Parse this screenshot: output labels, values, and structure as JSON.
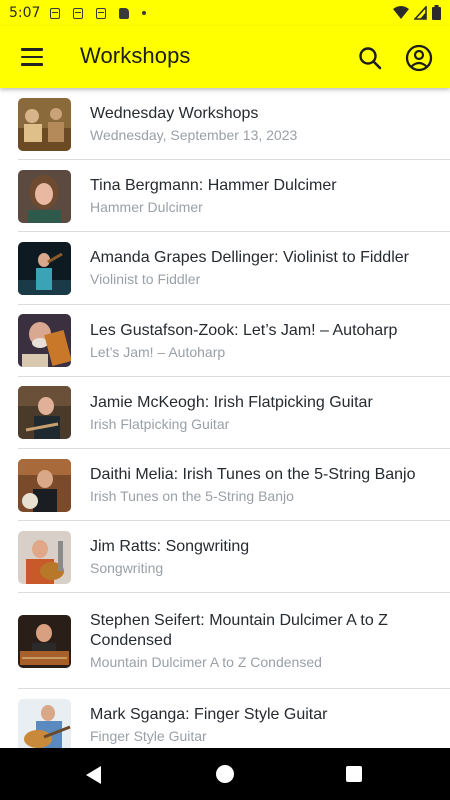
{
  "status_bar": {
    "time": "5:07",
    "icons": [
      "calendar-icon",
      "calendar-icon",
      "calendar-icon",
      "sd-card-icon",
      "dot-icon"
    ],
    "right_icons": [
      "wifi-icon",
      "signal-icon",
      "battery-icon"
    ]
  },
  "app_bar": {
    "title": "Workshops",
    "background": "#ffff00",
    "menu_icon": "menu-icon",
    "search_icon": "search-icon",
    "account_icon": "account-icon"
  },
  "workshops": [
    {
      "title": "Wednesday Workshops",
      "subtitle": "Wednesday, September 13, 2023"
    },
    {
      "title": "Tina Bergmann: Hammer Dulcimer",
      "subtitle": "Hammer Dulcimer"
    },
    {
      "title": "Amanda Grapes Dellinger: Violinist to Fiddler",
      "subtitle": "Violinist to Fiddler"
    },
    {
      "title": "Les Gustafson-Zook:  Let’s Jam! – Autoharp",
      "subtitle": "Let’s Jam! – Autoharp"
    },
    {
      "title": "Jamie McKeogh:  Irish Flatpicking Guitar",
      "subtitle": "Irish Flatpicking Guitar"
    },
    {
      "title": "Daithi Melia:  Irish Tunes on the 5-String Banjo",
      "subtitle": "Irish Tunes on the 5-String Banjo"
    },
    {
      "title": "Jim Ratts: Songwriting",
      "subtitle": "Songwriting"
    },
    {
      "title": "Stephen Seifert:  Mountain Dulcimer A to Z Condensed",
      "subtitle": "Mountain Dulcimer A to Z Condensed"
    },
    {
      "title": "Mark Sganga: Finger Style Guitar",
      "subtitle": "Finger Style Guitar"
    }
  ],
  "nav_bar": {
    "back_icon": "back-triangle-icon",
    "home_icon": "home-circle-icon",
    "recents_icon": "recents-square-icon"
  }
}
